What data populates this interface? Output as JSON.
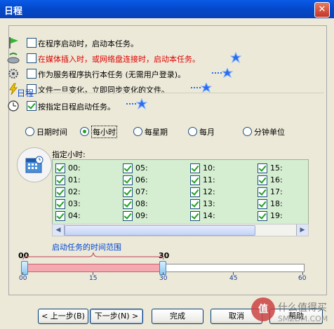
{
  "window": {
    "title": "日程",
    "close_glyph": "✕"
  },
  "options": [
    {
      "label": "在程序启动时，启动本任务。",
      "checked": false,
      "red": false,
      "star": false
    },
    {
      "label": "在媒体插入时，或网络盘连接时，启动本任务。",
      "checked": false,
      "red": true,
      "star": true
    },
    {
      "label": "作为服务程序执行本任务 (无需用户登录)。",
      "checked": false,
      "red": false,
      "star": true
    },
    {
      "label": "文件一旦变化，立即同步变化的文件。",
      "checked": false,
      "red": false,
      "star": true
    },
    {
      "label": "按指定日程启动任务。",
      "checked": true,
      "red": false,
      "star": true
    }
  ],
  "schedule": {
    "legend": "日程",
    "radios": [
      {
        "label": "日期时间",
        "selected": false
      },
      {
        "label": "每小时",
        "selected": true
      },
      {
        "label": "每星期",
        "selected": false
      },
      {
        "label": "每月",
        "selected": false
      },
      {
        "label": "分钟单位",
        "selected": false
      }
    ],
    "hours_title": "指定小时:",
    "hours": [
      "00:",
      "05:",
      "10:",
      "15:",
      "01:",
      "06:",
      "11:",
      "16:",
      "02:",
      "07:",
      "12:",
      "17:",
      "03:",
      "08:",
      "13:",
      "18:",
      "04:",
      "09:",
      "14:",
      "19:"
    ],
    "hours_checked": true
  },
  "range": {
    "start_label": "00",
    "end_label": "30",
    "caption": "启动任务的时间范围",
    "start_value": 0,
    "end_value": 30,
    "max_value": 60,
    "ticks": [
      "00",
      "15",
      "30",
      "45",
      "60"
    ]
  },
  "buttons": {
    "back": "< 上一步(B)",
    "next": "下一步(N) >",
    "finish": "完成",
    "cancel": "取消",
    "help": "帮助"
  },
  "watermark": {
    "badge": "值",
    "line1": "什么值得买",
    "line2": "SMZDM.COM"
  },
  "colors": {
    "accent_blue": "#0046D5",
    "red_text": "#E00000",
    "panel_green": "#D5EED1",
    "range_fill": "#F4AAB0"
  }
}
